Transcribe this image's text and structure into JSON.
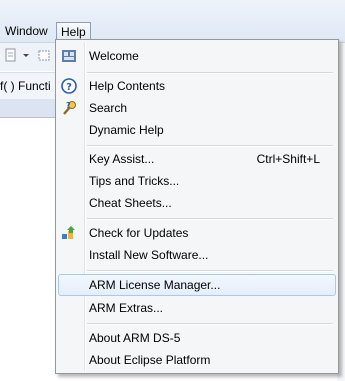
{
  "menubar": {
    "window_label": "Window",
    "help_label": "Help"
  },
  "funcbar": {
    "label": "f( )  Functi"
  },
  "help_menu": {
    "welcome": "Welcome",
    "help_contents": "Help Contents",
    "search": "Search",
    "dynamic_help": "Dynamic Help",
    "key_assist": "Key Assist...",
    "key_assist_shortcut": "Ctrl+Shift+L",
    "tips_and_tricks": "Tips and Tricks...",
    "cheat_sheets": "Cheat Sheets...",
    "check_for_updates": "Check for Updates",
    "install_new_software": "Install New Software...",
    "arm_license_manager": "ARM License Manager...",
    "arm_extras": "ARM Extras...",
    "about_arm_ds5": "About ARM DS-5",
    "about_eclipse_platform": "About Eclipse Platform"
  }
}
